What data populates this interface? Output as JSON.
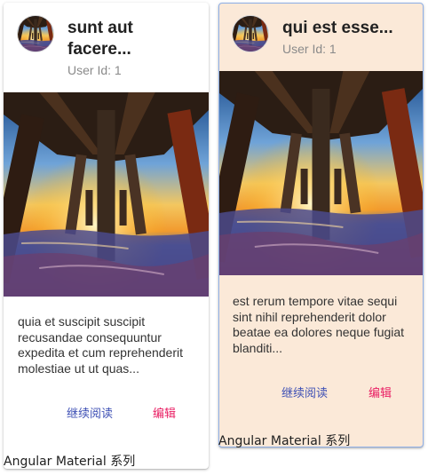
{
  "cards": [
    {
      "title_line1": "sunt aut",
      "title_line2": "facere...",
      "subtitle": "User Id: 1",
      "content": [
        "quia et suscipit suscipit",
        "recusandae consequuntur",
        "expedita et cum reprehenderit",
        "molestiae ut ut quas..."
      ],
      "read_more": "继续阅读",
      "edit": "编辑",
      "footer": "Angular Material 系列"
    },
    {
      "title_line1": "qui est esse...",
      "subtitle": "User Id: 1",
      "content": [
        "est rerum tempore vitae sequi",
        "sint nihil reprehenderit dolor",
        "beatae ea dolores neque fugiat",
        "blanditi..."
      ],
      "read_more": "继续阅读",
      "edit": "编辑",
      "footer": "Angular Material 系列"
    }
  ],
  "colors": {
    "primary": "#3f51b5",
    "warn": "#e91e63",
    "selected_card_bg": "#fbe9d8"
  },
  "icons": {
    "avatar": "pier-sunset-avatar",
    "image": "pier-sunset-photo"
  }
}
